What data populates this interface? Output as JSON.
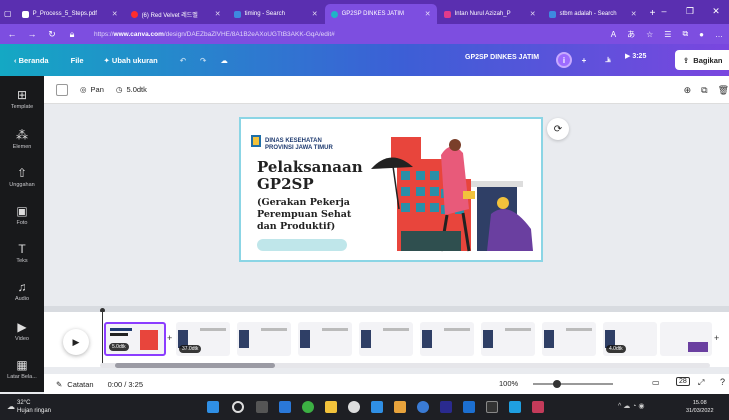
{
  "browser": {
    "tabs": [
      {
        "title": "P_Process_5_Steps.pdf",
        "color": "#ffffff"
      },
      {
        "title": "(6) Red Velvet 레드벨",
        "color": "#ff2d2d"
      },
      {
        "title": "timing - Search",
        "color": "#3e8ae0"
      },
      {
        "title": "GP2SP DINKES JATIM",
        "color": "#1fb4c7"
      },
      {
        "title": "Intan Nurul Azizah_P",
        "color": "#e23b8c"
      },
      {
        "title": "stbm adalah - Search",
        "color": "#3e8ae0"
      }
    ],
    "new_tab": "+",
    "url_prefix": "https://",
    "url_host": "www.canva.com",
    "url_path": "/design/DAEZbaZlVHE/8A1B2eAXoUGTtB3AKK-GqA/edit#",
    "window_controls": [
      "–",
      "❐",
      "✕"
    ]
  },
  "menu": {
    "back": "Beranda",
    "file": "File",
    "resize": "Ubah ukuran",
    "doc_title": "GP2SP DINKES JATIM",
    "present_time": "3:25",
    "share": "Bagikan"
  },
  "sidebar": [
    {
      "label": "Template",
      "icon": "template-icon"
    },
    {
      "label": "Elemen",
      "icon": "elements-icon"
    },
    {
      "label": "Unggahan",
      "icon": "upload-icon"
    },
    {
      "label": "Foto",
      "icon": "photo-icon"
    },
    {
      "label": "Teks",
      "icon": "text-icon"
    },
    {
      "label": "Audio",
      "icon": "audio-icon"
    },
    {
      "label": "Video",
      "icon": "video-icon"
    },
    {
      "label": "Latar Bela...",
      "icon": "background-icon"
    }
  ],
  "toolbar": {
    "pan": "Pan",
    "duration": "5.0dtk"
  },
  "slide": {
    "org_line1": "DINAS KESEHATAN",
    "org_line2": "PROVINSI JAWA TIMUR",
    "title_line1": "Pelaksanaan",
    "title_line2": "GP2SP",
    "subtitle_line1": "(Gerakan Pekerja",
    "subtitle_line2": "Perempuan Sehat",
    "subtitle_line3": "dan Produktif)"
  },
  "timeline": {
    "first_duration": "5.0dtk",
    "second_duration": "37.0dtk",
    "last_duration": "4.0dtk"
  },
  "bottom": {
    "notes": "Catatan",
    "time": "0:00 / 3:25",
    "zoom": "100%",
    "page": "28"
  },
  "taskbar": {
    "temp": "32°C",
    "weather": "Hujan ringan",
    "time": "15.08",
    "date": "31/03/2022"
  },
  "colors": {
    "browser_chrome": "#5a2fb0",
    "canva_purple": "#8b3dff",
    "slide_border": "#8bd5e5",
    "title_text": "#222222"
  }
}
